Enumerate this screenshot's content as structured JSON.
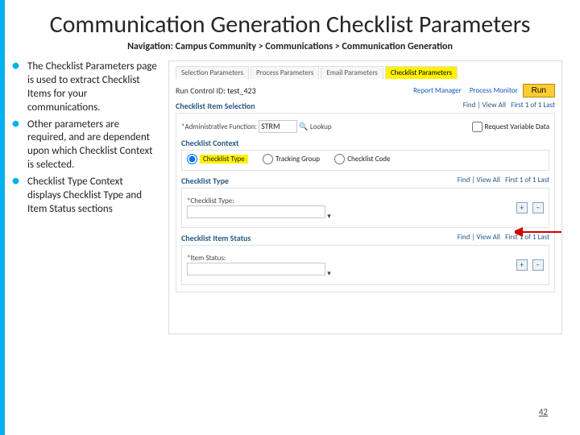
{
  "title": "Communication Generation Checklist Parameters",
  "breadcrumb": "Navigation: Campus Community > Communications > Communication Generation",
  "bullets": [
    "The Checklist Parameters page is used to extract Checklist Items for your communications.",
    "Other parameters are required, and are dependent upon which Checklist Context is selected.",
    "Checklist Type Context displays Checklist Type and Item Status sections"
  ],
  "tabs": [
    "Selection Parameters",
    "Process Parameters",
    "Email Parameters",
    "Checklist Parameters"
  ],
  "run_control_lbl": "Run Control ID:",
  "run_control_val": "test_423",
  "report_manager": "Report Manager",
  "process_monitor": "Process Monitor",
  "run_btn": "Run",
  "sec_checklist_item": "Checklist Item Selection",
  "find_viewall": "Find | View All",
  "first_last": "First   1 of 1   Last",
  "admin_func_lbl": "*Administrative Function:",
  "admin_func_val": "STRM",
  "lookup_hint": "Lookup",
  "request_var_lbl": "Request Variable Data",
  "checklist_context_hdr": "Checklist Context",
  "radio_type": "Checklist Type",
  "radio_group": "Tracking Group",
  "radio_code": "Checklist Code",
  "checklist_type_hdr": "Checklist Type",
  "checklist_type_field_lbl": "*Checklist Type:",
  "item_status_hdr": "Checklist Item Status",
  "item_status_field_lbl": "*Item Status:",
  "plus": "+",
  "minus": "−",
  "page_num": "42"
}
